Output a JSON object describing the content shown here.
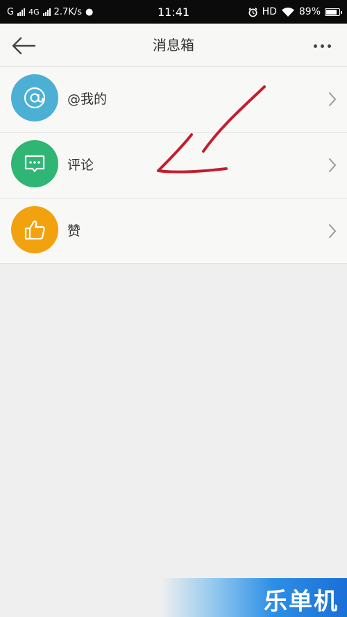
{
  "status_bar": {
    "carrier_left": "G",
    "network_type": "4G",
    "speed": "2.7K/s",
    "time": "11:41",
    "hd": "HD",
    "battery_percent": "89%"
  },
  "header": {
    "title": "消息箱",
    "back_icon": "back-arrow-icon",
    "more_icon": "more-dots-icon"
  },
  "list": {
    "items": [
      {
        "label": "@我的",
        "icon": "at-icon",
        "color": "#4bb0d4"
      },
      {
        "label": "评论",
        "icon": "comment-icon",
        "color": "#2fb574"
      },
      {
        "label": "赞",
        "icon": "thumbs-up-icon",
        "color": "#f2a20f"
      }
    ]
  },
  "colors": {
    "annotation": "#c21e2e",
    "background": "#efefef"
  },
  "watermark": {
    "text": "乐单机"
  }
}
